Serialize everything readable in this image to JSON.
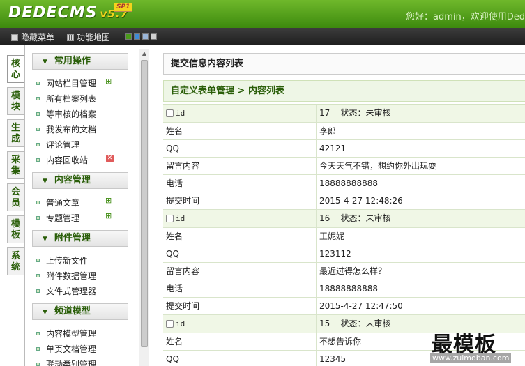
{
  "header": {
    "logo": "DEDECMS",
    "version": "v5.7",
    "badge": "SP1",
    "welcome": "您好：admin，欢迎使用Ded"
  },
  "toolbar": {
    "hide_menu": "隐藏菜单",
    "function_map": "功能地图",
    "swatches": [
      "#4a9a1a",
      "#3e8ad6",
      "#9ab6d8",
      "#cfcfcf"
    ]
  },
  "tabs": [
    "核心",
    "模块",
    "生成",
    "采集",
    "会员",
    "模板",
    "系统"
  ],
  "menu": {
    "section1": "常用操作",
    "section1_items": [
      "网站栏目管理",
      "所有档案列表",
      "等审核的档案",
      "我发布的文档",
      "评论管理",
      "内容回收站"
    ],
    "section2": "内容管理",
    "section2_items": [
      "普通文章",
      "专题管理"
    ],
    "section3": "附件管理",
    "section3_items": [
      "上传新文件",
      "附件数据管理",
      "文件式管理器"
    ],
    "section4": "频道模型",
    "section4_items": [
      "内容模型管理",
      "单页文档管理",
      "联动类别管理"
    ]
  },
  "content": {
    "title": "提交信息内容列表",
    "breadcrumb": "自定义表单管理 > 内容列表",
    "status_label": "状态：未审核",
    "field_labels": {
      "id": "id",
      "name": "姓名",
      "qq": "QQ",
      "message": "留言内容",
      "phone": "电话",
      "time": "提交时间"
    },
    "records": [
      {
        "id": "17",
        "name": "李郎",
        "qq": "42121",
        "message": "今天天气不错，想约你外出玩耍",
        "phone": "18888888888",
        "time": "2015-4-27 12:48:26"
      },
      {
        "id": "16",
        "name": "王妮妮",
        "qq": "123112",
        "message": "最近过得怎么样？",
        "phone": "18888888888",
        "time": "2015-4-27 12:47:50"
      },
      {
        "id": "15",
        "name": "不想告诉你",
        "qq": "12345"
      }
    ]
  },
  "watermark": {
    "text": "最模板",
    "url": "www.zuimoban.com"
  }
}
